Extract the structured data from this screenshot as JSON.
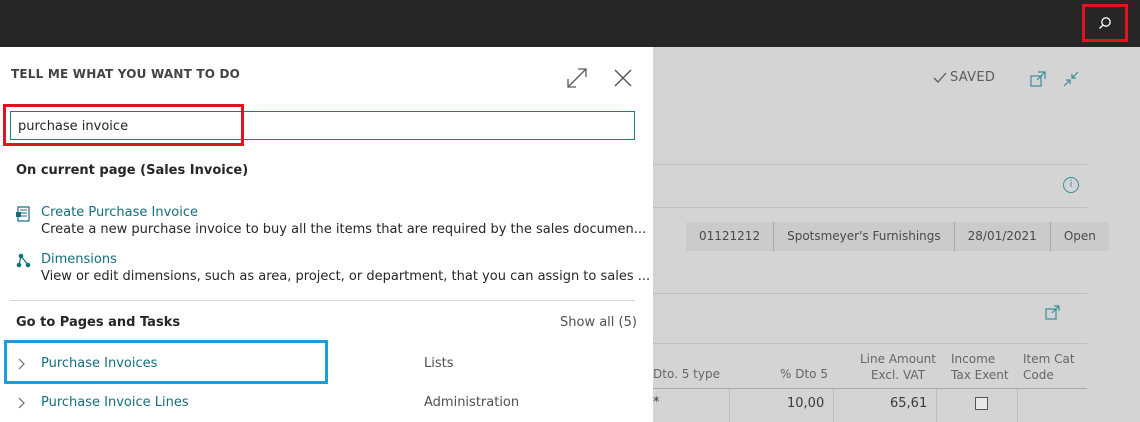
{
  "topbar": {
    "search_icon": "search-icon"
  },
  "tellme": {
    "title": "TELL ME WHAT YOU WANT TO DO",
    "expand_icon": "expand-icon",
    "close_icon": "close-icon",
    "search": {
      "value": "purchase invoice",
      "placeholder": ""
    },
    "current_page_section": "On current page (Sales Invoice)",
    "current_page_results": [
      {
        "icon": "document-icon",
        "title": "Create Purchase Invoice",
        "description": "Create a new purchase invoice to buy all the items that are required by the sales documen..."
      },
      {
        "icon": "dimensions-icon",
        "title": "Dimensions",
        "description": "View or edit dimensions, such as area, project, or department, that you can assign to sales ..."
      }
    ],
    "pages_section": "Go to Pages and Tasks",
    "show_all": "Show all (5)",
    "pages_results": [
      {
        "label": "Purchase Invoices",
        "category": "Lists"
      },
      {
        "label": "Purchase Invoice Lines",
        "category": "Administration"
      }
    ]
  },
  "background_page": {
    "saved_label": "SAVED",
    "header_chips": [
      "01121212",
      "Spotsmeyer's Furnishings",
      "28/01/2021",
      "Open"
    ],
    "columns": [
      {
        "line1": "Dto. 5 type",
        "line2": ""
      },
      {
        "line1": "% Dto 5",
        "line2": ""
      },
      {
        "line1": "Line Amount",
        "line2": "Excl. VAT"
      },
      {
        "line1": "Income",
        "line2": "Tax Exent"
      },
      {
        "line1": "Item Cat",
        "line2": "Code"
      }
    ],
    "row": {
      "dto5_type": "*",
      "pct_dto5": "10,00",
      "line_amount": "65,61",
      "income_tax_exent": false
    }
  },
  "colors": {
    "accent": "#136f7d",
    "highlight_red": "#e0141e",
    "highlight_blue": "#1c9fd8",
    "topbar": "#262626"
  }
}
